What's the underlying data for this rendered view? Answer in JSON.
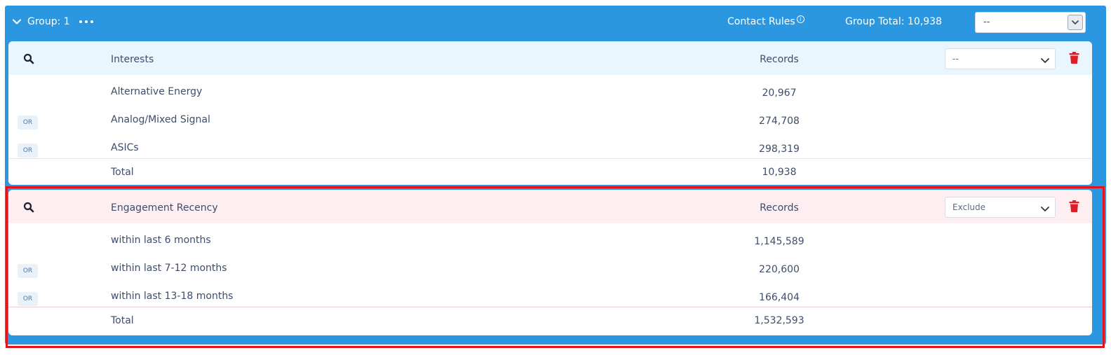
{
  "group": {
    "title": "Group: 1",
    "contact_rules_label": "Contact Rules",
    "contact_rules_info": "i",
    "group_total_label": "Group Total: 10,938",
    "select_value": "--"
  },
  "cards": [
    {
      "header": {
        "name": "Interests",
        "records_label": "Records",
        "select_value": "--"
      },
      "rows": [
        {
          "badge": "",
          "name": "Alternative Energy",
          "records": "20,967"
        },
        {
          "badge": "OR",
          "name": "Analog/Mixed Signal",
          "records": "274,708"
        },
        {
          "badge": "OR",
          "name": "ASICs",
          "records": "298,319"
        }
      ],
      "total": {
        "label": "Total",
        "records": "10,938"
      }
    },
    {
      "header": {
        "name": "Engagement Recency",
        "records_label": "Records",
        "select_value": "Exclude"
      },
      "rows": [
        {
          "badge": "",
          "name": "within last 6 months",
          "records": "1,145,589"
        },
        {
          "badge": "OR",
          "name": "within last 7-12 months",
          "records": "220,600"
        },
        {
          "badge": "OR",
          "name": "within last 13-18 months",
          "records": "166,404"
        }
      ],
      "total": {
        "label": "Total",
        "records": "1,532,593"
      }
    }
  ],
  "colors": {
    "group_blue": "#2a97e0",
    "card1_header": "#eaf6fe",
    "card2_header": "#fdeef1",
    "trash_red": "#dc1f26",
    "highlight_red": "#e3141b"
  }
}
